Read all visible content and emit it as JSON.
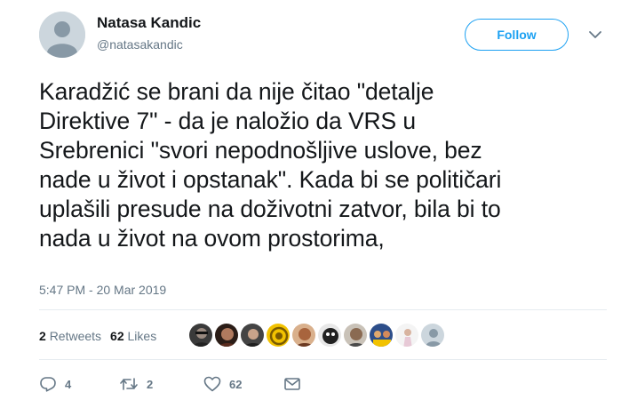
{
  "author": {
    "name": "Natasa Kandic",
    "handle": "@natasakandic"
  },
  "follow_label": "Follow",
  "tweet_text": "Karadžić se brani da nije čitao \"detalje\nDirektive 7\" - da je naložio da VRS u\nSrebrenici \"svori nepodnošljive uslove, bez\nnade u život i opstanak\". Kada bi se političari\nuplašili presude na doživotni zatvor, bila bi to\nnada  u život na ovom prostorima,",
  "timestamp": "5:47 PM - 20 Mar 2019",
  "stats": {
    "retweets_count": "2",
    "retweets_label": "Retweets",
    "likes_count": "62",
    "likes_label": "Likes"
  },
  "actions": {
    "reply_count": "4",
    "retweet_count": "2",
    "like_count": "62"
  },
  "icons": {
    "reply": "reply-icon",
    "retweet": "retweet-icon",
    "like": "heart-icon",
    "message": "envelope-icon",
    "caret": "chevron-down-icon"
  },
  "colors": {
    "accent": "#1da1f2",
    "muted": "#657786",
    "text": "#14171a",
    "divider": "#e6ecf0"
  }
}
